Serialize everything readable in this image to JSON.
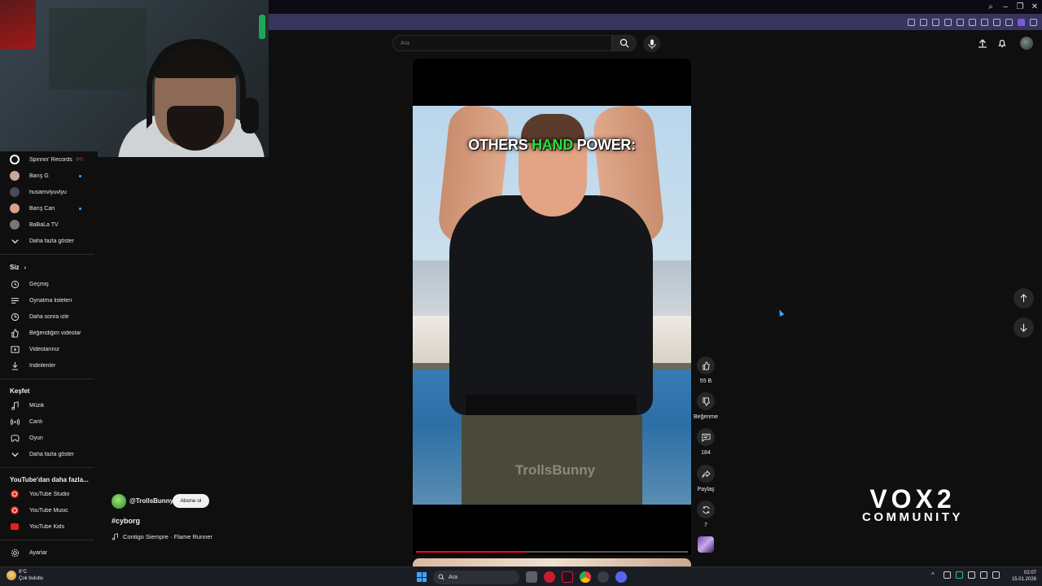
{
  "search": {
    "placeholder": "Ara"
  },
  "sidebar": {
    "subscriptions": [
      {
        "label": "Spinnin' Records",
        "badge": "live",
        "avatar_color": "#111111"
      },
      {
        "label": "Barış G",
        "badge": "dot",
        "avatar_color": "#c9a89a"
      },
      {
        "label": "husamvlyuvlyu",
        "badge": "",
        "avatar_color": "#4a4a55"
      },
      {
        "label": "Barış Can",
        "badge": "dot",
        "avatar_color": "#d9a08a"
      },
      {
        "label": "BaBaLa TV",
        "badge": "",
        "avatar_color": "#777777"
      }
    ],
    "show_more_subs": "Daha fazla göster",
    "you_heading": "Siz",
    "you_items": [
      {
        "label": "Geçmiş",
        "icon": "history-icon"
      },
      {
        "label": "Oynatma listeleri",
        "icon": "playlists-icon"
      },
      {
        "label": "Daha sonra izle",
        "icon": "watch-later-icon"
      },
      {
        "label": "Beğendiğim videolar",
        "icon": "liked-videos-icon"
      },
      {
        "label": "Videolarınız",
        "icon": "your-videos-icon"
      },
      {
        "label": "İndirilenler",
        "icon": "downloads-icon"
      }
    ],
    "explore_heading": "Keşfet",
    "explore_items": [
      {
        "label": "Müzik",
        "icon": "music-icon"
      },
      {
        "label": "Canlı",
        "icon": "live-icon"
      },
      {
        "label": "Oyun",
        "icon": "gaming-icon"
      },
      {
        "label": "Daha fazla göster",
        "icon": "chevron-down-icon"
      }
    ],
    "more_heading": "YouTube'dan daha fazla...",
    "more_items": [
      {
        "label": "YouTube Studio"
      },
      {
        "label": "YouTube Music"
      },
      {
        "label": "YouTube Kids"
      }
    ],
    "settings_label": "Ayarlar"
  },
  "short": {
    "caption_part1": "OTHERS ",
    "caption_highlight": "HAND",
    "caption_part2": " POWER:",
    "watermark": "TrollsBunny",
    "progress": 0.4,
    "channel": "@TrollsBunny",
    "subscribe": "Abone ol",
    "hashtag": "#cyborg",
    "music": "Contigo Siempre · Flame Runner"
  },
  "actions": {
    "like_count": "55 B",
    "dislike_label": "Beğenme",
    "comment_count": "184",
    "share_label": "Paylaş",
    "remix_count": "7"
  },
  "overlay": {
    "brand_line1": "VOX2",
    "brand_line2": "COMMUNITY"
  },
  "taskbar": {
    "weather_temp": "8°C",
    "weather_desc": "Çok bulutlu",
    "search_placeholder": "Ara",
    "time": "02:07",
    "date": "15.01.2026"
  },
  "colors": {
    "accent_red": "#ff0033",
    "caption_highlight": "#27e03a",
    "toolbar": "#37345e"
  }
}
